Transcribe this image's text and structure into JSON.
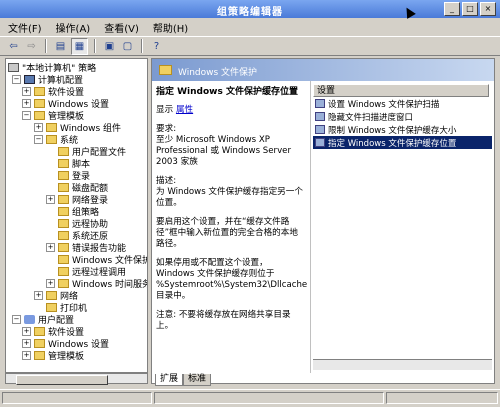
{
  "window": {
    "title": "组策略编辑器"
  },
  "menu": [
    "文件(F)",
    "操作(A)",
    "查看(V)",
    "帮助(H)"
  ],
  "tree": [
    {
      "label": "\"本地计算机\" 策略",
      "icon": "policy-icon"
    },
    {
      "label": "计算机配置",
      "icon": "computer-icon"
    },
    {
      "label": "软件设置",
      "icon": "folder-icon"
    },
    {
      "label": "Windows 设置",
      "icon": "folder-icon"
    },
    {
      "label": "管理模板",
      "icon": "folder-icon"
    },
    {
      "label": "Windows 组件",
      "icon": "folder-icon"
    },
    {
      "label": "系统",
      "icon": "folder-icon"
    },
    {
      "label": "用户配置文件",
      "icon": "folder-icon"
    },
    {
      "label": "脚本",
      "icon": "folder-icon"
    },
    {
      "label": "登录",
      "icon": "folder-icon"
    },
    {
      "label": "磁盘配额",
      "icon": "folder-icon"
    },
    {
      "label": "网络登录",
      "icon": "folder-icon"
    },
    {
      "label": "组策略",
      "icon": "folder-icon"
    },
    {
      "label": "远程协助",
      "icon": "folder-icon"
    },
    {
      "label": "系统还原",
      "icon": "folder-icon"
    },
    {
      "label": "错误报告功能",
      "icon": "folder-icon"
    },
    {
      "label": "Windows 文件保护",
      "icon": "folder-icon"
    },
    {
      "label": "远程过程调用",
      "icon": "folder-icon"
    },
    {
      "label": "Windows 时间服务",
      "icon": "folder-icon"
    },
    {
      "label": "网络",
      "icon": "folder-icon"
    },
    {
      "label": "打印机",
      "icon": "folder-icon"
    },
    {
      "label": "用户配置",
      "icon": "user-icon"
    },
    {
      "label": "软件设置",
      "icon": "folder-icon"
    },
    {
      "label": "Windows 设置",
      "icon": "folder-icon"
    },
    {
      "label": "管理模板",
      "icon": "folder-icon"
    }
  ],
  "right_header": "Windows 文件保护",
  "description": {
    "title": "指定 Windows 文件保护缓存位置",
    "show_label": "显示",
    "properties_link": "属性",
    "requirements_label": "要求:",
    "requirements_text": "至少 Microsoft Windows XP Professional 或 Windows Server 2003 家族",
    "desc_label": "描述:",
    "desc_text": "为 Windows 文件保护缓存指定另一个位置。",
    "para1": "要启用这个设置，并在“缓存文件路径”框中输入新位置的完全合格的本地路径。",
    "para2": "如果停用或不配置这个设置，Windows 文件保护缓存则位于 %Systemroot%\\System32\\Dllcache 目录中。",
    "para3": "注意: 不要将缓存放在网络共享目录上。"
  },
  "settings": {
    "column_header": "设置",
    "items": [
      "设置 Windows 文件保护扫描",
      "隐藏文件扫描进度窗口",
      "限制 Windows 文件保护缓存大小",
      "指定 Windows 文件保护缓存位置"
    ]
  },
  "tabs": [
    "扩展",
    "标准"
  ]
}
